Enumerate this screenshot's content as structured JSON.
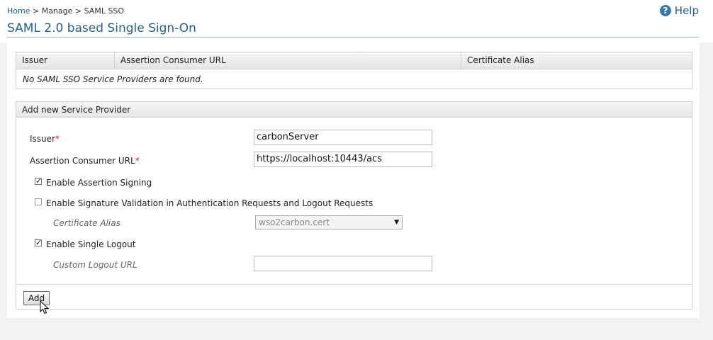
{
  "breadcrumb": {
    "home": "Home",
    "sep1": " > ",
    "manage": "Manage",
    "sep2": " > ",
    "current": "SAML SSO"
  },
  "help": {
    "icon": "?",
    "label": "Help"
  },
  "page_title": "SAML 2.0 based Single Sign-On",
  "providers_table": {
    "headers": [
      "Issuer",
      "Assertion Consumer URL",
      "Certificate Alias"
    ],
    "empty_message": "No SAML SSO Service Providers are found."
  },
  "add_form": {
    "title": "Add new Service Provider",
    "issuer": {
      "label": "Issuer",
      "required_mark": "*",
      "value": "carbonServer"
    },
    "acs_url": {
      "label": "Assertion Consumer URL",
      "required_mark": "*",
      "value": "https://localhost:10443/acs"
    },
    "enable_assertion_signing": {
      "label": "Enable Assertion Signing",
      "checked": true
    },
    "enable_signature_validation": {
      "label": "Enable Signature Validation in Authentication Requests and Logout Requests",
      "checked": false
    },
    "certificate_alias": {
      "label": "Certificate Alias",
      "selected": "wso2carbon.cert"
    },
    "enable_single_logout": {
      "label": "Enable Single Logout",
      "checked": true
    },
    "custom_logout_url": {
      "label": "Custom Logout URL",
      "value": ""
    },
    "add_button": "Add"
  },
  "colors": {
    "accent": "#27608e",
    "required": "#cc2222"
  },
  "icons": {
    "help": "help-circle-icon",
    "check": "check-icon",
    "dropdown": "chevron-down-icon",
    "cursor": "mouse-pointer-icon"
  }
}
